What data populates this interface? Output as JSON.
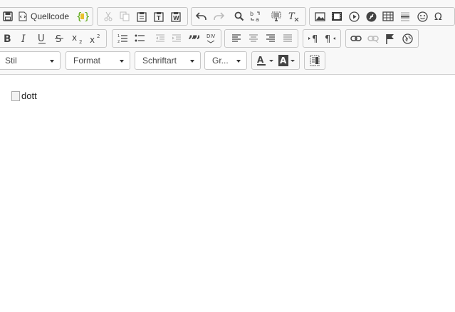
{
  "toolbar": {
    "row1": {
      "source_label": "Quellcode"
    },
    "row3": {
      "style_label": "Stil",
      "format_label": "Format",
      "font_label": "Schriftart",
      "size_label": "Gr..."
    }
  },
  "editor": {
    "image_alt": "dott"
  },
  "colors": {
    "toolbar_bg": "#f8f8f8",
    "border": "#c6c6c6",
    "icon": "#444444",
    "icon_disabled": "#bdbdbd",
    "accent_green": "#5ca815"
  },
  "icons": [
    "save-icon",
    "source-icon",
    "templates-icon",
    "cut-icon",
    "copy-icon",
    "paste-icon",
    "paste-text-icon",
    "paste-word-icon",
    "undo-icon",
    "redo-icon",
    "find-icon",
    "replace-icon",
    "select-all-icon",
    "remove-format-icon",
    "image-icon",
    "flash-icon",
    "video-icon",
    "iframe-icon",
    "table-icon",
    "horizontal-rule-icon",
    "smiley-icon",
    "special-char-icon",
    "bold-icon",
    "italic-icon",
    "underline-icon",
    "strike-icon",
    "subscript-icon",
    "superscript-icon",
    "numbered-list-icon",
    "bulleted-list-icon",
    "outdent-icon",
    "indent-icon",
    "blockquote-icon",
    "div-icon",
    "align-left-icon",
    "align-center-icon",
    "align-right-icon",
    "justify-icon",
    "ltr-icon",
    "rtl-icon",
    "link-icon",
    "unlink-icon",
    "anchor-icon",
    "language-icon",
    "text-color-icon",
    "background-color-icon",
    "blocks-icon"
  ]
}
